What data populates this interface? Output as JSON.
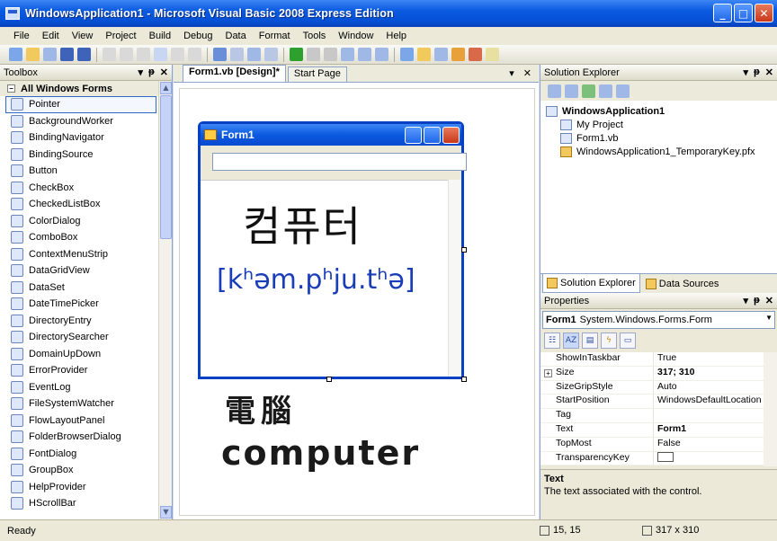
{
  "window": {
    "title": "WindowsApplication1 - Microsoft Visual Basic 2008 Express Edition",
    "min": "_",
    "max": "□",
    "close": "✕"
  },
  "menu": [
    "File",
    "Edit",
    "View",
    "Project",
    "Build",
    "Debug",
    "Data",
    "Format",
    "Tools",
    "Window",
    "Help"
  ],
  "toolbox": {
    "title": "Toolbox",
    "group": "All Windows Forms",
    "items": [
      "Pointer",
      "BackgroundWorker",
      "BindingNavigator",
      "BindingSource",
      "Button",
      "CheckBox",
      "CheckedListBox",
      "ColorDialog",
      "ComboBox",
      "ContextMenuStrip",
      "DataGridView",
      "DataSet",
      "DateTimePicker",
      "DirectoryEntry",
      "DirectorySearcher",
      "DomainUpDown",
      "ErrorProvider",
      "EventLog",
      "FileSystemWatcher",
      "FlowLayoutPanel",
      "FolderBrowserDialog",
      "FontDialog",
      "GroupBox",
      "HelpProvider",
      "HScrollBar"
    ]
  },
  "document": {
    "tabs": [
      "Form1.vb [Design]*",
      "Start Page"
    ],
    "form_title": "Form1"
  },
  "overlay": {
    "korean": "컴퓨터",
    "ipa": "[kʰəm.pʰju.tʰə]",
    "hanzi": "電腦",
    "english": "computer"
  },
  "solution_explorer": {
    "title": "Solution Explorer",
    "tree": [
      "WindowsApplication1",
      "My Project",
      "Form1.vb",
      "WindowsApplication1_TemporaryKey.pfx"
    ],
    "tabs": [
      "Solution Explorer",
      "Data Sources"
    ]
  },
  "properties": {
    "title": "Properties",
    "object_name": "Form1",
    "object_type": "System.Windows.Forms.Form",
    "rows": [
      {
        "name": "ShowInTaskbar",
        "value": "True"
      },
      {
        "name": "Size",
        "value": "317; 310"
      },
      {
        "name": "SizeGripStyle",
        "value": "Auto"
      },
      {
        "name": "StartPosition",
        "value": "WindowsDefaultLocation"
      },
      {
        "name": "Tag",
        "value": ""
      },
      {
        "name": "Text",
        "value": "Form1"
      },
      {
        "name": "TopMost",
        "value": "False"
      },
      {
        "name": "TransparencyKey",
        "value": ""
      }
    ],
    "desc_title": "Text",
    "desc_text": "The text associated with the control."
  },
  "status": {
    "text": "Ready",
    "position": "15, 15",
    "size": "317 x 310"
  },
  "colors": {
    "titlebar": "#0a5ae0",
    "accent_blue": "#1a3db8",
    "panel": "#ece9d8"
  }
}
